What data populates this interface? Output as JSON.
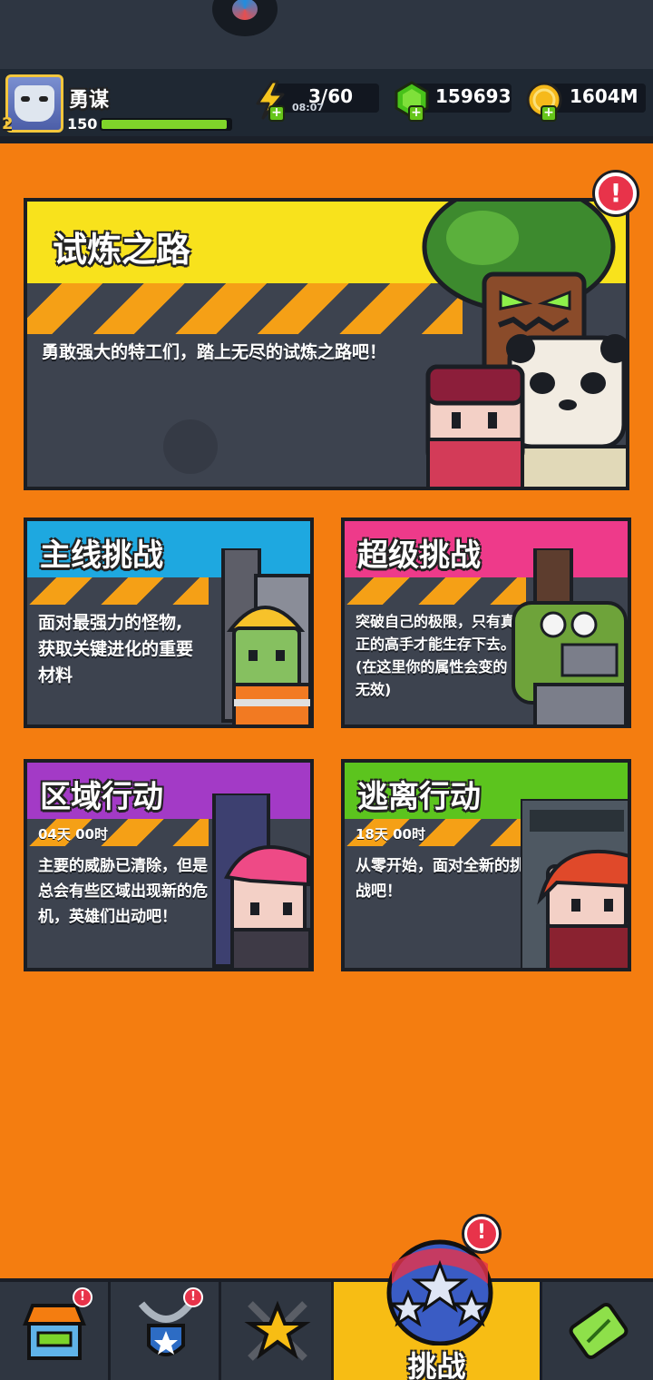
{
  "player": {
    "name": "勇谋",
    "rank": "2",
    "level": "150",
    "xp_fraction": 0.97
  },
  "resources": {
    "energy": {
      "value": "3/60",
      "timer": "08:07",
      "icon": "lightning-icon"
    },
    "gems": {
      "value": "159693",
      "icon": "green-gem-icon"
    },
    "coins": {
      "value": "1604M",
      "icon": "gold-coin-icon"
    }
  },
  "cards": {
    "trial": {
      "title": "试炼之路",
      "desc": "勇敢强大的特工们，踏上无尽的试炼之路吧！",
      "color": "#f8e21c",
      "alert": "!"
    },
    "main": {
      "title": "主线挑战",
      "desc": "面对最强力的怪物,获取关键进化的重要材料",
      "color": "#1ea8e0"
    },
    "super": {
      "title": "超级挑战",
      "desc": "突破自己的极限，只有真正的高手才能生存下去。(在这里你的属性会变的无效)",
      "color": "#ee3a8a"
    },
    "zone": {
      "title": "区域行动",
      "timer": "04天 00时",
      "desc": "主要的威胁已清除，但是总会有些区域出现新的危机，英雄们出动吧！",
      "color": "#a33ac6"
    },
    "escape": {
      "title": "逃离行动",
      "timer": "18天 00时",
      "desc": "从零开始，面对全新的挑战吧！",
      "color": "#5cc41e"
    }
  },
  "nav": {
    "items": [
      {
        "name": "shop",
        "icon": "shop-icon",
        "badge": "!"
      },
      {
        "name": "equipment",
        "icon": "shield-necklace-icon",
        "badge": "!"
      },
      {
        "name": "heroes",
        "icon": "star-swords-icon"
      },
      {
        "name": "challenge",
        "icon": "star-ball-icon",
        "label": "挑战",
        "active": true,
        "badge": "!"
      },
      {
        "name": "evolution",
        "icon": "dna-capsule-icon"
      }
    ]
  }
}
